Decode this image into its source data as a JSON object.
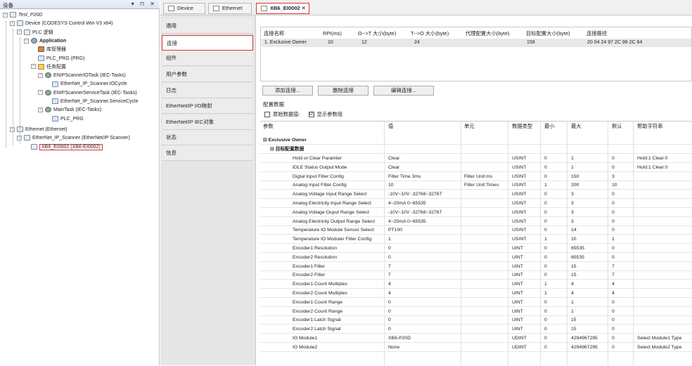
{
  "device_panel": {
    "title": "设备",
    "controls": "▾ ⊓ ✕",
    "tree": [
      {
        "label": "Test_P20D",
        "indent": 0,
        "icon": "project-icon"
      },
      {
        "label": "Device (CODESYS Control Win V3 x64)",
        "indent": 1,
        "icon": "device-icon"
      },
      {
        "label": "PLC 逻辑",
        "indent": 2,
        "icon": "plc-logic-icon"
      },
      {
        "label": "Application",
        "indent": 3,
        "icon": "application-icon",
        "bold": true
      },
      {
        "label": "库管理器",
        "indent": 4,
        "icon": "library-icon"
      },
      {
        "label": "PLC_PRG (PRG)",
        "indent": 4,
        "icon": "program-icon"
      },
      {
        "label": "任务配置",
        "indent": 4,
        "icon": "task-config-icon"
      },
      {
        "label": "ENIPScannerIOTask (IEC-Tasks)",
        "indent": 5,
        "icon": "task-icon"
      },
      {
        "label": "EtherNet_IP_Scanner.IOCycle",
        "indent": 6,
        "icon": "call-icon"
      },
      {
        "label": "ENIPScannerServiceTask (IEC-Tasks)",
        "indent": 5,
        "icon": "task-icon"
      },
      {
        "label": "EtherNet_IP_Scanner.ServiceCycle",
        "indent": 6,
        "icon": "call-icon"
      },
      {
        "label": "MainTask (IEC-Tasks)",
        "indent": 5,
        "icon": "task-icon"
      },
      {
        "label": "PLC_PRG",
        "indent": 6,
        "icon": "call-icon"
      },
      {
        "label": "Ethernet (Ethernet)",
        "indent": 1,
        "icon": "ethernet-icon"
      },
      {
        "label": "EtherNet_IP_Scanner (EtherNet/IP Scanner)",
        "indent": 2,
        "icon": "scanner-icon"
      },
      {
        "label": "XB6_EI0002 (XB6-EI0002)",
        "indent": 3,
        "icon": "module-icon",
        "selected": true
      }
    ]
  },
  "tabs": [
    {
      "label": "Device"
    },
    {
      "label": "Ethernet"
    },
    {
      "label": "XB6_EI0002",
      "close": "✕"
    }
  ],
  "subtabs": [
    "通用",
    "连接",
    "组件",
    "用户参数",
    "日志",
    "EtherNet/IP I/O映射",
    "EtherNet/IP IEC对象",
    "状态",
    "信息"
  ],
  "connections": {
    "headers": [
      "连接名称",
      "RPI(ms)",
      "O-->T 大小(byte)",
      "T-->O 大小(byte)",
      "代理配置大小(byte)",
      "目标配置大小(byte)",
      "连接路径"
    ],
    "row": [
      "1. Exclusive Owner",
      "10",
      "12",
      "24",
      "",
      "158",
      "20 04 24 97 2C 96 2C 64"
    ]
  },
  "buttons": {
    "add": "添加连接...",
    "delete": "删除连接",
    "edit": "编辑连接..."
  },
  "config": {
    "title": "配置数据",
    "raw_label": "原始数据值:",
    "show_groups_label": "显示参数组",
    "show_groups_check": "☑"
  },
  "grid": {
    "headers": [
      "参数",
      "值",
      "单元",
      "数据类型",
      "最小",
      "最大",
      "默认",
      "帮助字符串"
    ],
    "group1": "Exclusive Owner",
    "group2": "目标配置数据",
    "rows": [
      [
        "Hold or Clear Paramter",
        "Clear",
        "",
        "USINT",
        "0",
        "1",
        "0",
        "Hold:1 Clear:0"
      ],
      [
        "IDLE Status Output Mode",
        "Clear",
        "",
        "USINT",
        "0",
        "1",
        "0",
        "Hold:1 Clear:0"
      ],
      [
        "Digtal Input Filter Config",
        "Filter Time 3ms",
        "Filter Unit:ms",
        "USINT",
        "0",
        "150",
        "3",
        ""
      ],
      [
        "Analog Input Filter Config",
        "10",
        "Filter Unit:Times",
        "USINT",
        "1",
        "200",
        "10",
        ""
      ],
      [
        "Analog Voltage Input Range Select",
        "-10V~10V -32768~32767",
        "",
        "USINT",
        "0",
        "3",
        "0",
        ""
      ],
      [
        "Analog Electricity Input Range Select",
        "4~20mA 0~65535",
        "",
        "USINT",
        "0",
        "3",
        "0",
        ""
      ],
      [
        "Analog Voltage Ouput Range Select",
        "-10V~10V -32768~32767",
        "",
        "USINT",
        "0",
        "3",
        "0",
        ""
      ],
      [
        "Analog Electricity Output Range Select",
        "4~20mA 0~65535",
        "",
        "USINT",
        "0",
        "3",
        "0",
        ""
      ],
      [
        "Temperature IO Module Sensor Select",
        "PT100",
        "",
        "USINT",
        "0",
        "14",
        "0",
        ""
      ],
      [
        "Temperature IO Moduler Filter Config",
        "1",
        "",
        "USINT",
        "1",
        "10",
        "1",
        ""
      ],
      [
        "Encoder1 Resolution",
        "0",
        "",
        "UINT",
        "0",
        "65535",
        "0",
        ""
      ],
      [
        "Encoder2 Resolution",
        "0",
        "",
        "UINT",
        "0",
        "65535",
        "0",
        ""
      ],
      [
        "Encoder1 Filter",
        "7",
        "",
        "UINT",
        "0",
        "15",
        "7",
        ""
      ],
      [
        "Encoder2 Filter",
        "7",
        "",
        "UINT",
        "0",
        "15",
        "7",
        ""
      ],
      [
        "Encoder1 Count Multiples",
        "4",
        "",
        "UINT",
        "1",
        "4",
        "4",
        ""
      ],
      [
        "Encoder2 Count Multiples",
        "4",
        "",
        "UINT",
        "1",
        "4",
        "4",
        ""
      ],
      [
        "Encoder1 Count Range",
        "0",
        "",
        "UINT",
        "0",
        "1",
        "0",
        ""
      ],
      [
        "Encoder2 Count Range",
        "0",
        "",
        "UINT",
        "0",
        "1",
        "0",
        ""
      ],
      [
        "Encoder1 Latch Signal",
        "0",
        "",
        "UINT",
        "0",
        "15",
        "0",
        ""
      ],
      [
        "Encoder2 Latch Signal",
        "0",
        "",
        "UINT",
        "0",
        "15",
        "0",
        ""
      ],
      [
        "IO Module1",
        "XB6-P20D",
        "",
        "UDINT",
        "0",
        "4294967295",
        "0",
        "Select Module1 Type"
      ],
      [
        "IO Module2",
        "None",
        "",
        "UDINT",
        "0",
        "4294967295",
        "0",
        "Select Module2 Type"
      ]
    ]
  }
}
